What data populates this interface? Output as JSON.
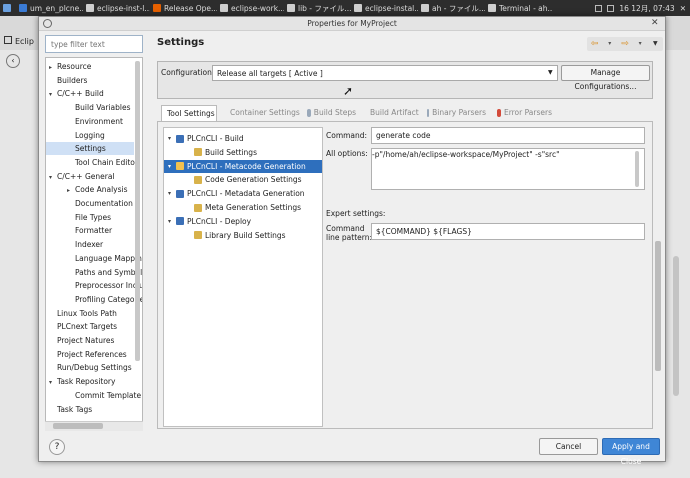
{
  "taskbar": {
    "items": [
      {
        "label": "um_en_plcne...",
        "icon": "document-icon",
        "color": "#3a7bd5"
      },
      {
        "label": "eclipse-inst-l...",
        "icon": "window-icon",
        "color": "#cfcfcf"
      },
      {
        "label": "Release Ope...",
        "icon": "firefox-icon",
        "color": "#e66000"
      },
      {
        "label": "eclipse-work...",
        "icon": "window-icon",
        "color": "#cfcfcf"
      },
      {
        "label": "lib - ファイル...",
        "icon": "folder-icon",
        "color": "#cfcfcf"
      },
      {
        "label": "eclipse-instal...",
        "icon": "folder-icon",
        "color": "#cfcfcf"
      },
      {
        "label": "ah - ファイル...",
        "icon": "folder-icon",
        "color": "#cfcfcf"
      },
      {
        "label": "Terminal - ah...",
        "icon": "terminal-icon",
        "color": "#cfcfcf"
      }
    ],
    "clock": "16 12月, 07:43"
  },
  "background_app": {
    "label": "Eclip"
  },
  "dialog": {
    "title": "Properties for MyProject",
    "filter_placeholder": "type filter text",
    "help_glyph": "?",
    "cancel": "Cancel",
    "apply_close": "Apply and Close"
  },
  "tree": [
    {
      "label": "Resource",
      "level": 0,
      "arrow": "▸"
    },
    {
      "label": "Builders",
      "level": 0,
      "arrow": ""
    },
    {
      "label": "C/C++ Build",
      "level": 0,
      "arrow": "▾"
    },
    {
      "label": "Build Variables",
      "level": 1,
      "arrow": ""
    },
    {
      "label": "Environment",
      "level": 1,
      "arrow": ""
    },
    {
      "label": "Logging",
      "level": 1,
      "arrow": ""
    },
    {
      "label": "Settings",
      "level": 1,
      "arrow": "",
      "selected": true
    },
    {
      "label": "Tool Chain Editor",
      "level": 1,
      "arrow": ""
    },
    {
      "label": "C/C++ General",
      "level": 0,
      "arrow": "▾"
    },
    {
      "label": "Code Analysis",
      "level": 1,
      "arrow": "▸"
    },
    {
      "label": "Documentation",
      "level": 1,
      "arrow": ""
    },
    {
      "label": "File Types",
      "level": 1,
      "arrow": ""
    },
    {
      "label": "Formatter",
      "level": 1,
      "arrow": ""
    },
    {
      "label": "Indexer",
      "level": 1,
      "arrow": ""
    },
    {
      "label": "Language Mappings",
      "level": 1,
      "arrow": ""
    },
    {
      "label": "Paths and Symbols",
      "level": 1,
      "arrow": ""
    },
    {
      "label": "Preprocessor Includ",
      "level": 1,
      "arrow": ""
    },
    {
      "label": "Profiling Categories",
      "level": 1,
      "arrow": ""
    },
    {
      "label": "Linux Tools Path",
      "level": 0,
      "arrow": ""
    },
    {
      "label": "PLCnext Targets",
      "level": 0,
      "arrow": ""
    },
    {
      "label": "Project Natures",
      "level": 0,
      "arrow": ""
    },
    {
      "label": "Project References",
      "level": 0,
      "arrow": ""
    },
    {
      "label": "Run/Debug Settings",
      "level": 0,
      "arrow": ""
    },
    {
      "label": "Task Repository",
      "level": 0,
      "arrow": "▾"
    },
    {
      "label": "Commit Template",
      "level": 1,
      "arrow": ""
    },
    {
      "label": "Task Tags",
      "level": 0,
      "arrow": ""
    }
  ],
  "settings": {
    "title": "Settings",
    "config_label": "Configuration:",
    "config_value": "Release all targets  [ Active ]",
    "manage_button": "Manage Configurations...",
    "tabs": [
      {
        "label": "Tool Settings",
        "active": true,
        "icon": "tool-settings-icon",
        "color": "#3b6fb6"
      },
      {
        "label": "Container Settings",
        "active": false,
        "icon": "container-icon",
        "color": "#7aa7d8"
      },
      {
        "label": "Build Steps",
        "active": false,
        "icon": "build-steps-icon",
        "color": "#9aa9ba"
      },
      {
        "label": "Build Artifact",
        "active": false,
        "icon": "build-artifact-icon",
        "color": "#d8c06a"
      },
      {
        "label": "Binary Parsers",
        "active": false,
        "icon": "binary-parsers-icon",
        "color": "#9aa9ba"
      },
      {
        "label": "Error Parsers",
        "active": false,
        "icon": "error-parsers-icon",
        "color": "#d34a3a"
      }
    ],
    "tool_tree": [
      {
        "label": "PLCnCLI - Build",
        "level": 0,
        "arrow": "▾",
        "icon": "tool-icon",
        "color": "#3b6fb6"
      },
      {
        "label": "Build Settings",
        "level": 1,
        "arrow": "",
        "icon": "settings-icon",
        "color": "#d8b24a"
      },
      {
        "label": "PLCnCLI - Metacode Generation",
        "level": 0,
        "arrow": "▾",
        "icon": "tool-icon",
        "color": "#f2c14e",
        "selected": true
      },
      {
        "label": "Code Generation Settings",
        "level": 1,
        "arrow": "",
        "icon": "settings-icon",
        "color": "#d8b24a"
      },
      {
        "label": "PLCnCLI - Metadata Generation",
        "level": 0,
        "arrow": "▾",
        "icon": "tool-icon",
        "color": "#3b6fb6"
      },
      {
        "label": "Meta Generation Settings",
        "level": 1,
        "arrow": "",
        "icon": "settings-icon",
        "color": "#d8b24a"
      },
      {
        "label": "PLCnCLI - Deploy",
        "level": 0,
        "arrow": "▾",
        "icon": "tool-icon",
        "color": "#3b6fb6"
      },
      {
        "label": "Library Build Settings",
        "level": 1,
        "arrow": "",
        "icon": "settings-icon",
        "color": "#d8b24a"
      }
    ],
    "command_label": "Command:",
    "command_value": "generate code",
    "all_options_label": "All options:",
    "all_options_value": "-p\"/home/ah/eclipse-workspace/MyProject\" -s\"src\"",
    "expert_label": "Expert settings:",
    "pattern_label_1": "Command",
    "pattern_label_2": "line pattern:",
    "pattern_value": "${COMMAND} ${FLAGS}"
  },
  "colors": {
    "accent": "#3f86d6",
    "selection": "#2e6fbd",
    "nav_arrow": "#d88a18"
  }
}
